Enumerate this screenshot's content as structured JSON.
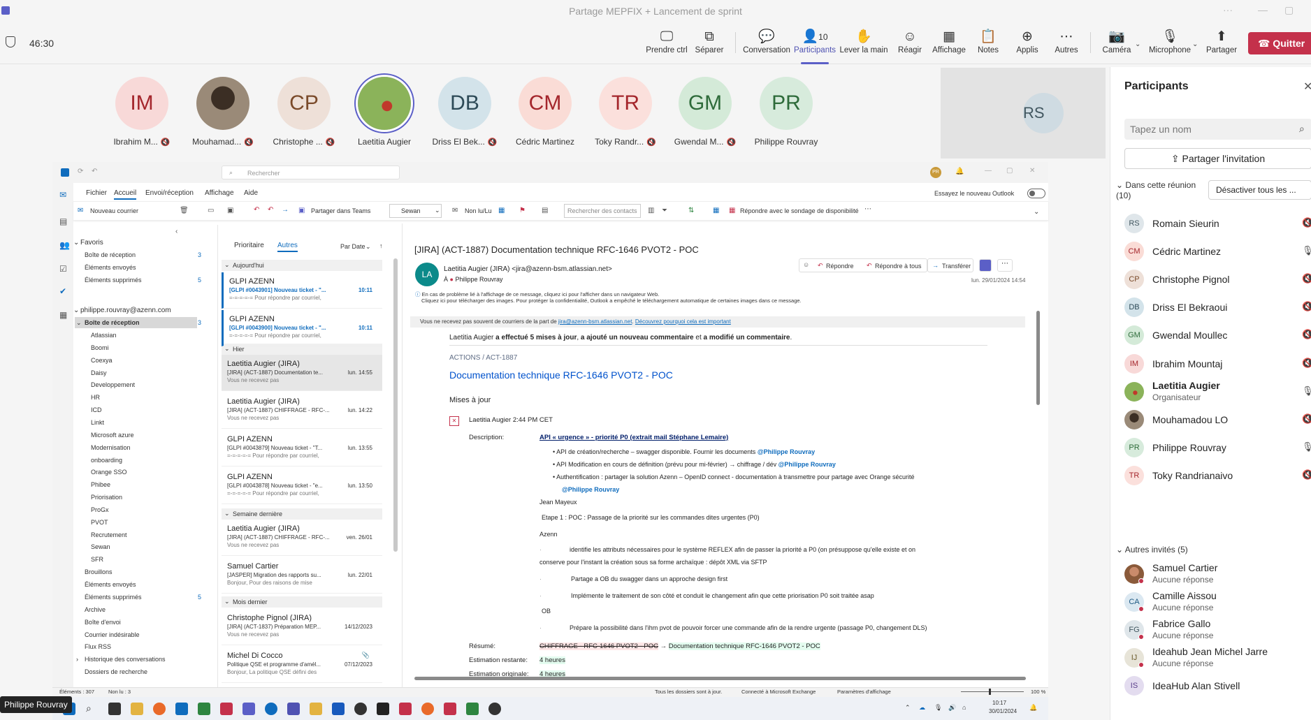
{
  "window": {
    "title": "Partage MEPFIX + Lancement de sprint",
    "timer": "46:30"
  },
  "toolbar": {
    "items": [
      {
        "label": "Prendre ctrl",
        "icon": "take-control-icon"
      },
      {
        "label": "Séparer",
        "icon": "popout-icon"
      },
      {
        "label": "Conversation",
        "icon": "chat-icon"
      },
      {
        "label": "Participants",
        "icon": "people-icon",
        "count": "10"
      },
      {
        "label": "Lever la main",
        "icon": "raise-hand-icon"
      },
      {
        "label": "Réagir",
        "icon": "react-icon"
      },
      {
        "label": "Affichage",
        "icon": "view-icon"
      },
      {
        "label": "Notes",
        "icon": "notes-icon"
      },
      {
        "label": "Applis",
        "icon": "apps-icon"
      },
      {
        "label": "Autres",
        "icon": "more-icon"
      },
      {
        "label": "Caméra",
        "icon": "camera-off-icon"
      },
      {
        "label": "Microphone",
        "icon": "mic-off-icon"
      },
      {
        "label": "Partager",
        "icon": "share-icon"
      }
    ],
    "quit_label": "Quitter"
  },
  "gallery": [
    {
      "initials": "IM",
      "name": "Ibrahim M...",
      "bg": "#f8d9d8",
      "fg": "#a4262c"
    },
    {
      "initials": "",
      "name": "Mouhamad...",
      "bg": "#6b5a4a",
      "fg": "#ffffff"
    },
    {
      "initials": "CP",
      "name": "Christophe ...",
      "bg": "#eee0d8",
      "fg": "#7a4a2a"
    },
    {
      "initials": "",
      "name": "Laetitia Augier",
      "bg": "#7fa34a",
      "fg": "#ffffff"
    },
    {
      "initials": "DB",
      "name": "Driss El Bek...",
      "bg": "#d3e3ea",
      "fg": "#2d4a57"
    },
    {
      "initials": "CM",
      "name": "Cédric Martinez",
      "bg": "#fadcd6",
      "fg": "#a4262c"
    },
    {
      "initials": "TR",
      "name": "Toky Randr...",
      "bg": "#fbe0dc",
      "fg": "#a4262c"
    },
    {
      "initials": "GM",
      "name": "Gwendal M...",
      "bg": "#d4ead8",
      "fg": "#2e6b3a"
    },
    {
      "initials": "PR",
      "name": "Philippe Rouvray",
      "bg": "#d7ebdc",
      "fg": "#2e6b3a"
    }
  ],
  "rs_tile": {
    "initials": "RS"
  },
  "outlook": {
    "search": "Rechercher",
    "menu": [
      "Fichier",
      "Accueil",
      "Envoi/réception",
      "Affichage",
      "Aide"
    ],
    "new_outlook": "Essayez le nouveau Outlook",
    "ribbon": {
      "new_mail": "Nouveau courrier",
      "share_teams": "Partager dans Teams",
      "sewan": "Sewan",
      "unread": "Non lu/Lu",
      "search_contacts": "Rechercher des contacts",
      "reply_poll": "Répondre avec le sondage de disponibilité"
    },
    "favorites_label": "Favoris",
    "favorites": [
      {
        "name": "Boîte de réception",
        "count": "3"
      },
      {
        "name": "Éléments envoyés",
        "count": ""
      },
      {
        "name": "Éléments supprimés",
        "count": "5"
      }
    ],
    "account": "philippe.rouvray@azenn.com",
    "inbox": {
      "name": "Boîte de réception",
      "count": "3"
    },
    "subfolders": [
      "Atlassian",
      "Boomi",
      "Coexya",
      "Daisy",
      "Developpement",
      "HR",
      "ICD",
      "Linkt",
      "Microsoft azure",
      "Modernisation",
      "onboarding",
      "Orange SSO",
      "Phibee",
      "Priorisation",
      "ProGx",
      "PVOT",
      "Recrutement",
      "Sewan",
      "SFR"
    ],
    "folders": [
      {
        "name": "Brouillons",
        "count": ""
      },
      {
        "name": "Éléments envoyés",
        "count": ""
      },
      {
        "name": "Éléments supprimés",
        "count": "5"
      },
      {
        "name": "Archive",
        "count": ""
      },
      {
        "name": "Boîte d'envoi",
        "count": ""
      },
      {
        "name": "Courrier indésirable",
        "count": ""
      },
      {
        "name": "Flux RSS",
        "count": ""
      },
      {
        "name": "Historique des conversations",
        "count": ""
      },
      {
        "name": "Dossiers de recherche",
        "count": ""
      }
    ],
    "list_tabs": [
      "Prioritaire",
      "Autres"
    ],
    "sort": "Par Date",
    "groups": [
      "Aujourd'hui",
      "Hier",
      "Semaine dernière",
      "Mois dernier"
    ],
    "mails": [
      {
        "from": "GLPI AZENN",
        "subject": "[GLPI #0043901] Nouveau ticket - \"...",
        "preview": "=-=-=-=-= Pour répondre par courriel,",
        "date": "10:11",
        "unread": true
      },
      {
        "from": "GLPI AZENN",
        "subject": "[GLPI #0043900] Nouveau ticket - \"...",
        "preview": "=-=-=-=-= Pour répondre par courriel,",
        "date": "10:11",
        "unread": true
      },
      {
        "from": "Laetitia Augier (JIRA)",
        "subject": "[JIRA] (ACT-1887) Documentation te...",
        "preview": "Vous ne recevez pas",
        "date": "lun. 14:55",
        "unread": false
      },
      {
        "from": "Laetitia Augier (JIRA)",
        "subject": "[JIRA] (ACT-1887) CHIFFRAGE - RFC-...",
        "preview": "Vous ne recevez pas",
        "date": "lun. 14:22",
        "unread": false
      },
      {
        "from": "GLPI AZENN",
        "subject": "[GLPI #0043879] Nouveau ticket - \"T...",
        "preview": "=-=-=-=-= Pour répondre par courriel,",
        "date": "lun. 13:55",
        "unread": false
      },
      {
        "from": "GLPI AZENN",
        "subject": "[GLPI #0043878] Nouveau ticket - \"e...",
        "preview": "=-=-=-=-= Pour répondre par courriel,",
        "date": "lun. 13:50",
        "unread": false
      },
      {
        "from": "Laetitia Augier (JIRA)",
        "subject": "[JIRA] (ACT-1887) CHIFFRAGE - RFC-...",
        "preview": "Vous ne recevez pas",
        "date": "ven. 26/01",
        "unread": false
      },
      {
        "from": "Samuel Cartier",
        "subject": "[JASPER] Migration des rapports su...",
        "preview": "Bonjour,  Pour des raisons de mise",
        "date": "lun. 22/01",
        "unread": false
      },
      {
        "from": "Christophe Pignol (JIRA)",
        "subject": "[JIRA] (ACT-1837) Préparation MEP...",
        "preview": "Vous ne recevez pas",
        "date": "14/12/2023",
        "unread": false
      },
      {
        "from": "Michel Di Cocco",
        "subject": "Politique QSE et programme d'amél...",
        "preview": "Bonjour,  La politique QSE défini des",
        "date": "07/12/2023",
        "unread": false
      }
    ],
    "reading": {
      "subject": "[JIRA] (ACT-1887) Documentation technique RFC-1646 PVOT2 - POC",
      "sender_initials": "LA",
      "sender": "Laetitia Augier (JIRA) <jira@azenn-bsm.atlassian.net>",
      "to_label": "À",
      "to": "Philippe Rouvray",
      "date": "lun. 29/01/2024 14:54",
      "info1": "En cas de problème lié à l'affichage de ce message, cliquez ici pour l'afficher dans un navigateur Web.",
      "info2": "Cliquez ici pour télécharger des images. Pour protéger la confidentialité, Outlook a empêché le téléchargement automatique de certaines images dans ce message.",
      "actions": [
        "Répondre",
        "Répondre à tous",
        "Transférer"
      ],
      "banner_a": "Vous ne recevez pas souvent de courriers de la part de ",
      "banner_link1": "jira@azenn-bsm.atlassian.net",
      "banner_b": ". ",
      "banner_link2": "Découvrez pourquoi cela est important",
      "intro_a": "Laetitia Augier ",
      "intro_b": "a effectué 5 mises à jour",
      "intro_c": ", ",
      "intro_d": "a ajouté un nouveau commentaire",
      "intro_e": " et ",
      "intro_f": "a modifié un commentaire",
      "intro_g": ".",
      "breadcrumb": "ACTIONS  /  ACT-1887",
      "issue_title": "Documentation technique RFC-1646 PVOT2 - POC",
      "updates_label": "Mises à jour",
      "update_meta": "Laetitia Augier 2:44 PM CET",
      "desc_label": "Description:",
      "desc_title": "API « urgence »  - priorité P0 (extrait mail Stéphane Lemaire)",
      "bullets": [
        {
          "text": "API de création/recherche – swagger disponible. Fournir les documents ",
          "mention": "@Philippe Rouvray"
        },
        {
          "text": "API Modification en cours de définition (prévu pour mi-février) → chiffrage / dév ",
          "mention": "@Philippe Rouvray"
        },
        {
          "text": "Authentification : partager la solution Azenn – OpenID connect - documentation à transmettre pour partage avec Orange sécurité",
          "mention": "@Philippe Rouvray"
        }
      ],
      "jean": "Jean Mayeux",
      "etape": "Etape 1 : POC : Passage de la priorité sur les commandes dites urgentes (P0)",
      "azenn": "Azenn",
      "azenn_line1": "identifie les attributs nécessaires pour le système REFLEX afin de passer la priorité a P0 (on présuppose qu'elle existe et on",
      "azenn_line2": "conserve pour l'instant la création sous sa forme archaïque : dépôt XML via SFTP",
      "azenn_line3": "Partage a OB du swagger dans un approche design first",
      "azenn_line4": "Implémente le traitement de son côté et conduit le changement afin que cette priorisation P0 soit traitée asap",
      "ob": "OB",
      "ob_line": "Prépare la possibilité dans l'ihm pvot de pouvoir forcer une commande afin de la rendre urgente (passage P0, changement DLS)",
      "resume_label": "Résumé:",
      "resume_old": "CHIFFRAGE - RFC-1646 PVOT2 - POC",
      "resume_arrow": "→",
      "resume_new": "Documentation technique RFC-1646 PVOT2 - POC",
      "estimate_label": "Estimation restante:",
      "estimate_value": "4 heures",
      "estimate2_label": "Estimation originale:",
      "estimate2_value": "4 heures"
    },
    "status": {
      "items": "Éléments : 307",
      "unread": "Non lu : 3",
      "sync": "Tous les dossiers sont à jour.",
      "conn": "Connecté à Microsoft Exchange",
      "display": "Paramètres d'affichage",
      "zoom": "100 %"
    },
    "clock": {
      "time": "10:17",
      "date": "30/01/2024"
    }
  },
  "panel": {
    "title": "Participants",
    "search_placeholder": "Tapez un nom",
    "invite": "Partager l'invitation",
    "in_meeting": "Dans cette réunion (10)",
    "deactivate": "Désactiver tous les ...",
    "members": [
      {
        "initials": "RS",
        "name": "Romain Sieurin",
        "sub": "",
        "bg": "#dfe6ea",
        "fg": "#41565f",
        "mic": "off"
      },
      {
        "initials": "CM",
        "name": "Cédric Martinez",
        "sub": "",
        "bg": "#fadcd6",
        "fg": "#a4262c",
        "mic": "on"
      },
      {
        "initials": "CP",
        "name": "Christophe Pignol",
        "sub": "",
        "bg": "#eee0d8",
        "fg": "#7a4a2a",
        "mic": "off"
      },
      {
        "initials": "DB",
        "name": "Driss El Bekraoui",
        "sub": "",
        "bg": "#d3e3ea",
        "fg": "#2d4a57",
        "mic": "off"
      },
      {
        "initials": "GM",
        "name": "Gwendal Moullec",
        "sub": "",
        "bg": "#d4ead8",
        "fg": "#2e6b3a",
        "mic": "off"
      },
      {
        "initials": "IM",
        "name": "Ibrahim Mountaj",
        "sub": "",
        "bg": "#f8d9d8",
        "fg": "#a4262c",
        "mic": "off"
      },
      {
        "initials": "",
        "name": "Laetitia Augier",
        "sub": "Organisateur",
        "bg": "#7fa34a",
        "fg": "#fff",
        "mic": "on"
      },
      {
        "initials": "",
        "name": "Mouhamadou LO",
        "sub": "",
        "bg": "#6b5a4a",
        "fg": "#fff",
        "mic": "off"
      },
      {
        "initials": "PR",
        "name": "Philippe Rouvray",
        "sub": "",
        "bg": "#d7ebdc",
        "fg": "#2e6b3a",
        "mic": "on"
      },
      {
        "initials": "TR",
        "name": "Toky Randrianaivo",
        "sub": "",
        "bg": "#fbe0dc",
        "fg": "#a4262c",
        "mic": "off"
      }
    ],
    "others": "Autres invités (5)",
    "guests": [
      {
        "initials": "",
        "name": "Samuel Cartier",
        "sub": "Aucune réponse",
        "bg": "#c98b6b",
        "fg": "#fff"
      },
      {
        "initials": "CA",
        "name": "Camille Aissou",
        "sub": "Aucune réponse",
        "bg": "#dbe8f1",
        "fg": "#205a83"
      },
      {
        "initials": "FG",
        "name": "Fabrice Gallo",
        "sub": "Aucune réponse",
        "bg": "#dfe6ea",
        "fg": "#41565f"
      },
      {
        "initials": "IJ",
        "name": "Ideahub Jean Michel Jarre",
        "sub": "Aucune réponse",
        "bg": "#e7e4d8",
        "fg": "#6a5a2a"
      },
      {
        "initials": "IS",
        "name": "IdeaHub Alan Stivell",
        "sub": "",
        "bg": "#e3dcef",
        "fg": "#5a3f8a"
      }
    ]
  },
  "nametag": "Philippe Rouvray"
}
